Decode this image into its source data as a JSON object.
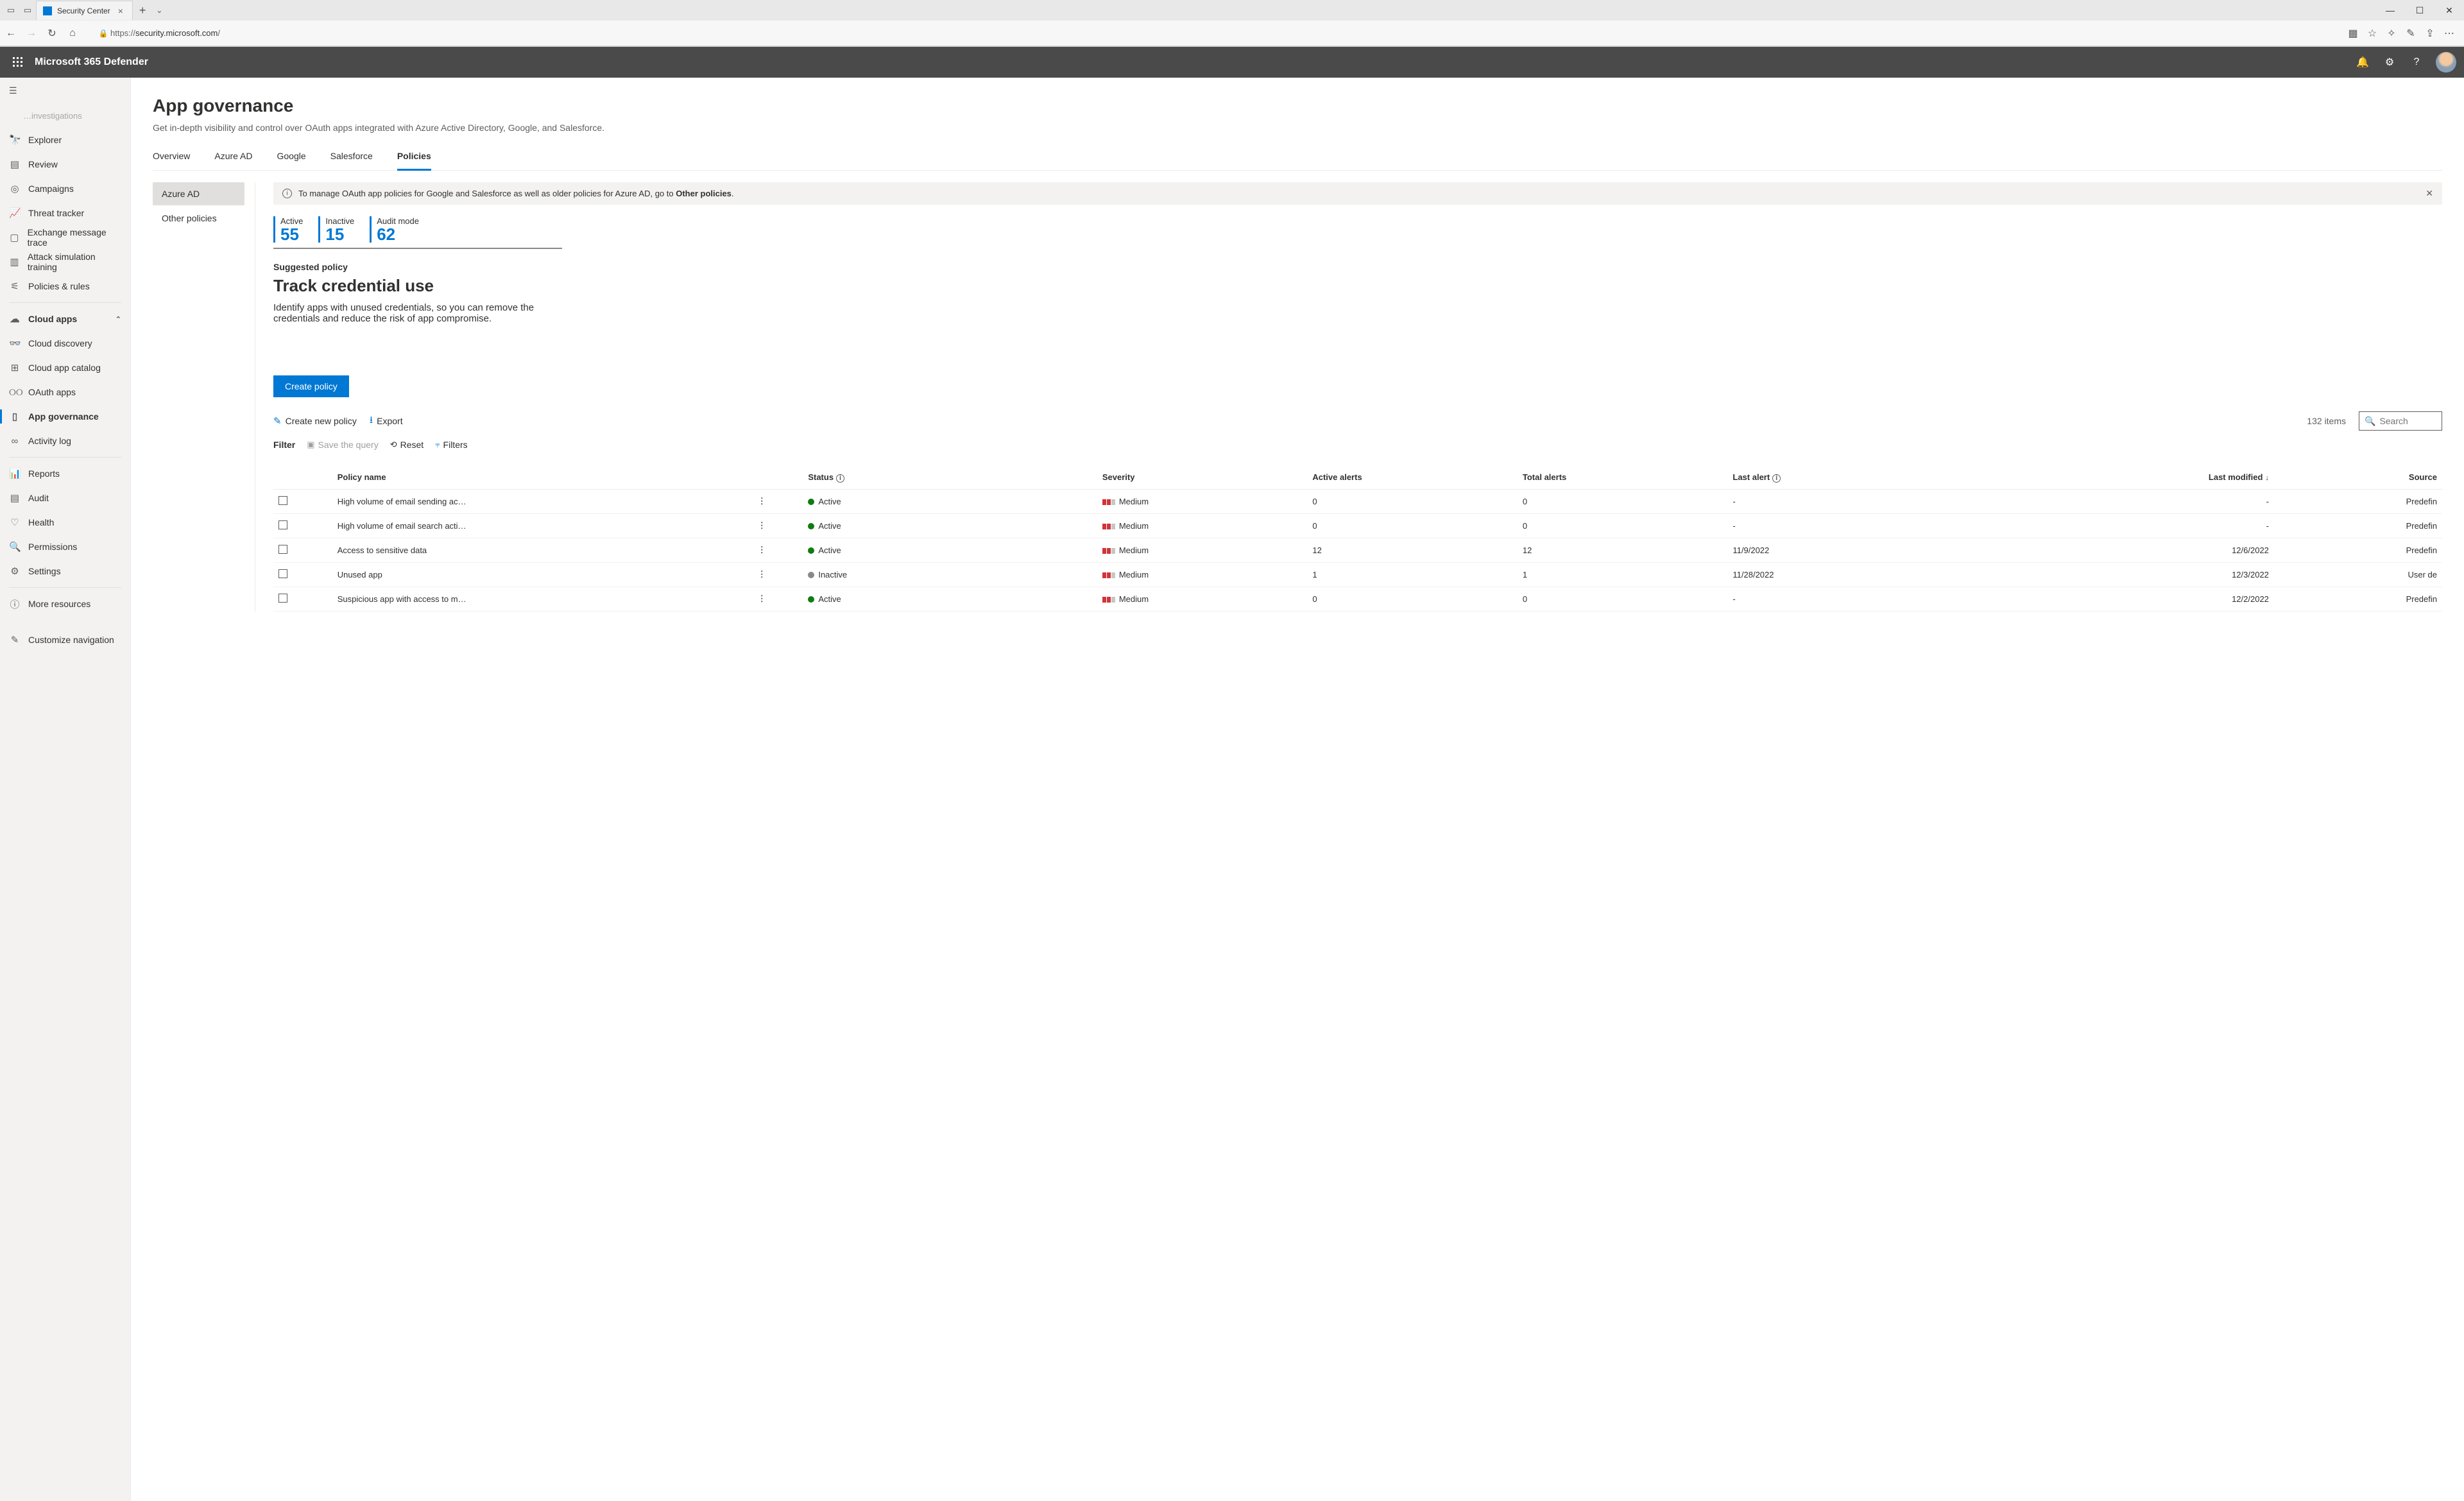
{
  "browser": {
    "tab_title": "Security Center",
    "url_prefix": "https://",
    "url_host": "security.microsoft.com",
    "url_path": "/"
  },
  "header": {
    "title": "Microsoft 365 Defender"
  },
  "nav": {
    "trunc": "…investigations",
    "items": [
      "Explorer",
      "Review",
      "Campaigns",
      "Threat tracker",
      "Exchange message trace",
      "Attack simulation training",
      "Policies & rules"
    ],
    "cloud_group": "Cloud apps",
    "cloud_items": [
      "Cloud discovery",
      "Cloud app catalog",
      "OAuth apps",
      "App governance",
      "Activity log"
    ],
    "bottom": [
      "Reports",
      "Audit",
      "Health",
      "Permissions",
      "Settings"
    ],
    "more": "More resources",
    "customize": "Customize navigation"
  },
  "page": {
    "title": "App governance",
    "desc": "Get in-depth visibility and control over OAuth apps integrated with Azure Active Directory, Google, and Salesforce.",
    "tabs": [
      "Overview",
      "Azure AD",
      "Google",
      "Salesforce",
      "Policies"
    ],
    "subtabs": [
      "Azure AD",
      "Other policies"
    ],
    "banner_text": "To manage OAuth app policies for Google and Salesforce as well as older policies for Azure AD, go to ",
    "banner_link": "Other policies",
    "stats": [
      {
        "label": "Active",
        "value": "55"
      },
      {
        "label": "Inactive",
        "value": "15"
      },
      {
        "label": "Audit mode",
        "value": "62"
      }
    ],
    "suggested_label": "Suggested policy",
    "suggested_title": "Track credential use",
    "suggested_desc": "Identify apps with unused credentials, so you can remove the credentials and reduce the risk of app compromise.",
    "create_btn": "Create policy",
    "tool_new": "Create new policy",
    "tool_export": "Export",
    "item_count": "132 items",
    "search_ph": "Search",
    "filter_label": "Filter",
    "filter_save": "Save the query",
    "filter_reset": "Reset",
    "filter_filters": "Filters"
  },
  "table": {
    "cols": [
      "Policy name",
      "Status",
      "Severity",
      "Active alerts",
      "Total alerts",
      "Last alert",
      "Last modified",
      "Source"
    ],
    "rows": [
      {
        "name": "High volume of email sending ac…",
        "status": "Active",
        "severity": "Medium",
        "active": "0",
        "total": "0",
        "last": "-",
        "mod": "-",
        "src": "Predefin"
      },
      {
        "name": "High volume of email search acti…",
        "status": "Active",
        "severity": "Medium",
        "active": "0",
        "total": "0",
        "last": "-",
        "mod": "-",
        "src": "Predefin"
      },
      {
        "name": "Access to sensitive data",
        "status": "Active",
        "severity": "Medium",
        "active": "12",
        "total": "12",
        "last": "11/9/2022",
        "mod": "12/6/2022",
        "src": "Predefin"
      },
      {
        "name": "Unused app",
        "status": "Inactive",
        "severity": "Medium",
        "active": "1",
        "total": "1",
        "last": "11/28/2022",
        "mod": "12/3/2022",
        "src": "User de"
      },
      {
        "name": "Suspicious app with access to m…",
        "status": "Active",
        "severity": "Medium",
        "active": "0",
        "total": "0",
        "last": "-",
        "mod": "12/2/2022",
        "src": "Predefin"
      }
    ]
  }
}
